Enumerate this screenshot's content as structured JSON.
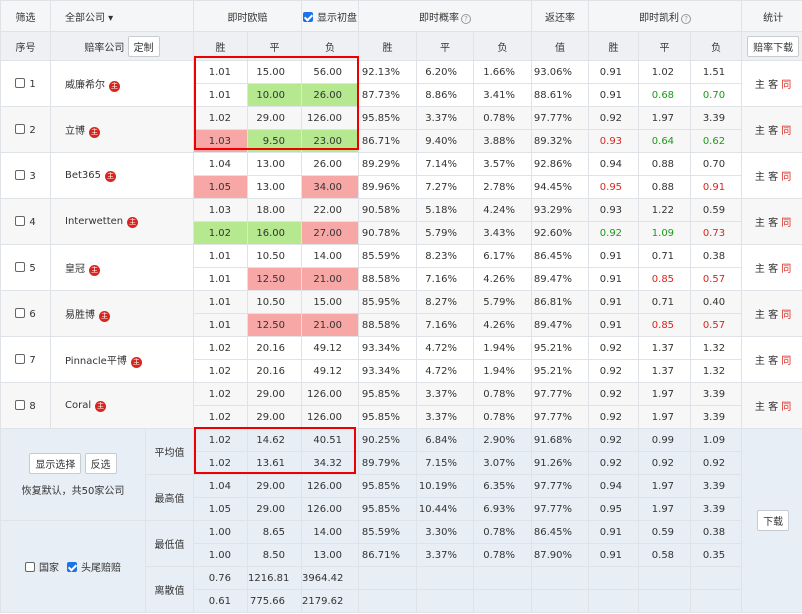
{
  "header": {
    "filter": "筛选",
    "company_dropdown": "全部公司",
    "instant_odds": "即时欧赔",
    "show_initial": "显示初盘",
    "instant_prob": "即时概率",
    "return_rate": "返还率",
    "instant_kelly": "即时凯利",
    "stats": "统计"
  },
  "subheader": {
    "seq": "序号",
    "company": "赔率公司",
    "customize": "定制",
    "win": "胜",
    "draw": "平",
    "lose": "负",
    "value": "值",
    "download": "赔率下载"
  },
  "companies": [
    {
      "seq": "1",
      "name": "威廉希尔",
      "rows": [
        {
          "odds": [
            "1.01",
            "15.00",
            "56.00"
          ],
          "prob": [
            "92.13%",
            "6.20%",
            "1.66%"
          ],
          "ret": "93.06%",
          "kelly": [
            "0.91",
            "1.02",
            "1.51"
          ]
        },
        {
          "odds": [
            "1.01",
            "10.00",
            "26.00"
          ],
          "prob": [
            "87.73%",
            "8.86%",
            "3.41%"
          ],
          "ret": "88.61%",
          "kelly": [
            "0.91",
            "0.68",
            "0.70"
          ]
        }
      ]
    },
    {
      "seq": "2",
      "name": "立博",
      "rows": [
        {
          "odds": [
            "1.02",
            "29.00",
            "126.00"
          ],
          "prob": [
            "95.85%",
            "3.37%",
            "0.78%"
          ],
          "ret": "97.77%",
          "kelly": [
            "0.92",
            "1.97",
            "3.39"
          ]
        },
        {
          "odds": [
            "1.03",
            "9.50",
            "23.00"
          ],
          "prob": [
            "86.71%",
            "9.40%",
            "3.88%"
          ],
          "ret": "89.32%",
          "kelly": [
            "0.93",
            "0.64",
            "0.62"
          ]
        }
      ]
    },
    {
      "seq": "3",
      "name": "Bet365",
      "rows": [
        {
          "odds": [
            "1.04",
            "13.00",
            "26.00"
          ],
          "prob": [
            "89.29%",
            "7.14%",
            "3.57%"
          ],
          "ret": "92.86%",
          "kelly": [
            "0.94",
            "0.88",
            "0.70"
          ]
        },
        {
          "odds": [
            "1.05",
            "13.00",
            "34.00"
          ],
          "prob": [
            "89.96%",
            "7.27%",
            "2.78%"
          ],
          "ret": "94.45%",
          "kelly": [
            "0.95",
            "0.88",
            "0.91"
          ]
        }
      ]
    },
    {
      "seq": "4",
      "name": "Interwetten",
      "rows": [
        {
          "odds": [
            "1.03",
            "18.00",
            "22.00"
          ],
          "prob": [
            "90.58%",
            "5.18%",
            "4.24%"
          ],
          "ret": "93.29%",
          "kelly": [
            "0.93",
            "1.22",
            "0.59"
          ]
        },
        {
          "odds": [
            "1.02",
            "16.00",
            "27.00"
          ],
          "prob": [
            "90.78%",
            "5.79%",
            "3.43%"
          ],
          "ret": "92.60%",
          "kelly": [
            "0.92",
            "1.09",
            "0.73"
          ]
        }
      ]
    },
    {
      "seq": "5",
      "name": "皇冠",
      "rows": [
        {
          "odds": [
            "1.01",
            "10.50",
            "14.00"
          ],
          "prob": [
            "85.59%",
            "8.23%",
            "6.17%"
          ],
          "ret": "86.45%",
          "kelly": [
            "0.91",
            "0.71",
            "0.38"
          ]
        },
        {
          "odds": [
            "1.01",
            "12.50",
            "21.00"
          ],
          "prob": [
            "88.58%",
            "7.16%",
            "4.26%"
          ],
          "ret": "89.47%",
          "kelly": [
            "0.91",
            "0.85",
            "0.57"
          ]
        }
      ]
    },
    {
      "seq": "6",
      "name": "易胜博",
      "rows": [
        {
          "odds": [
            "1.01",
            "10.50",
            "15.00"
          ],
          "prob": [
            "85.95%",
            "8.27%",
            "5.79%"
          ],
          "ret": "86.81%",
          "kelly": [
            "0.91",
            "0.71",
            "0.40"
          ]
        },
        {
          "odds": [
            "1.01",
            "12.50",
            "21.00"
          ],
          "prob": [
            "88.58%",
            "7.16%",
            "4.26%"
          ],
          "ret": "89.47%",
          "kelly": [
            "0.91",
            "0.85",
            "0.57"
          ]
        }
      ]
    },
    {
      "seq": "7",
      "name": "Pinnacle平博",
      "rows": [
        {
          "odds": [
            "1.02",
            "20.16",
            "49.12"
          ],
          "prob": [
            "93.34%",
            "4.72%",
            "1.94%"
          ],
          "ret": "95.21%",
          "kelly": [
            "0.92",
            "1.37",
            "1.32"
          ]
        },
        {
          "odds": [
            "1.02",
            "20.16",
            "49.12"
          ],
          "prob": [
            "93.34%",
            "4.72%",
            "1.94%"
          ],
          "ret": "95.21%",
          "kelly": [
            "0.92",
            "1.37",
            "1.32"
          ]
        }
      ]
    },
    {
      "seq": "8",
      "name": "Coral",
      "rows": [
        {
          "odds": [
            "1.02",
            "29.00",
            "126.00"
          ],
          "prob": [
            "95.85%",
            "3.37%",
            "0.78%"
          ],
          "ret": "97.77%",
          "kelly": [
            "0.92",
            "1.97",
            "3.39"
          ]
        },
        {
          "odds": [
            "1.02",
            "29.00",
            "126.00"
          ],
          "prob": [
            "95.85%",
            "3.37%",
            "0.78%"
          ],
          "ret": "97.77%",
          "kelly": [
            "0.92",
            "1.97",
            "3.39"
          ]
        }
      ]
    }
  ],
  "row_links": {
    "home": "主",
    "away": "客",
    "same": "同"
  },
  "badge_char": "主",
  "stats_panel": {
    "show_selected": "显示选择",
    "invert": "反选",
    "restore": "恢复默认，共50家公司",
    "domestic": "国家",
    "head_tail": "头尾赔赔",
    "download": "下载"
  },
  "stats": [
    {
      "label": "平均值",
      "rows": [
        {
          "odds": [
            "1.02",
            "14.62",
            "40.51"
          ],
          "prob": [
            "90.25%",
            "6.84%",
            "2.90%"
          ],
          "ret": "91.68%",
          "kelly": [
            "0.92",
            "0.99",
            "1.09"
          ]
        },
        {
          "odds": [
            "1.02",
            "13.61",
            "34.32"
          ],
          "prob": [
            "89.79%",
            "7.15%",
            "3.07%"
          ],
          "ret": "91.26%",
          "kelly": [
            "0.92",
            "0.92",
            "0.92"
          ]
        }
      ]
    },
    {
      "label": "最高值",
      "rows": [
        {
          "odds": [
            "1.04",
            "29.00",
            "126.00"
          ],
          "prob": [
            "95.85%",
            "10.19%",
            "6.35%"
          ],
          "ret": "97.77%",
          "kelly": [
            "0.94",
            "1.97",
            "3.39"
          ]
        },
        {
          "odds": [
            "1.05",
            "29.00",
            "126.00"
          ],
          "prob": [
            "95.85%",
            "10.44%",
            "6.93%"
          ],
          "ret": "97.77%",
          "kelly": [
            "0.95",
            "1.97",
            "3.39"
          ]
        }
      ]
    },
    {
      "label": "最低值",
      "rows": [
        {
          "odds": [
            "1.00",
            "8.65",
            "14.00"
          ],
          "prob": [
            "85.59%",
            "3.30%",
            "0.78%"
          ],
          "ret": "86.45%",
          "kelly": [
            "0.91",
            "0.59",
            "0.38"
          ]
        },
        {
          "odds": [
            "1.00",
            "8.50",
            "13.00"
          ],
          "prob": [
            "86.71%",
            "3.37%",
            "0.78%"
          ],
          "ret": "87.90%",
          "kelly": [
            "0.91",
            "0.58",
            "0.35"
          ]
        }
      ]
    },
    {
      "label": "离散值",
      "rows": [
        {
          "odds": [
            "0.76",
            "1216.81",
            "3964.42"
          ],
          "prob": [
            "",
            "",
            ""
          ],
          "ret": "",
          "kelly": [
            "",
            "",
            ""
          ]
        },
        {
          "odds": [
            "0.61",
            "775.66",
            "2179.62"
          ],
          "prob": [
            "",
            "",
            ""
          ],
          "ret": "",
          "kelly": [
            "",
            "",
            ""
          ]
        }
      ]
    }
  ],
  "colors": {
    "red": "#d9251d",
    "green": "#1a9a1a",
    "bg_green": "#b5e88f",
    "bg_red": "#f8a7a7"
  }
}
